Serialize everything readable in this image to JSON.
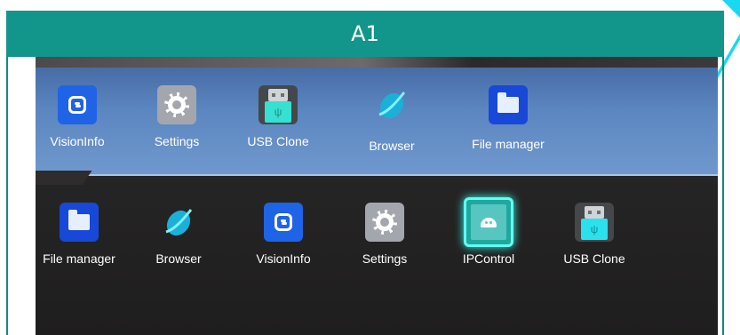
{
  "header": {
    "title": "A1"
  },
  "photo": {
    "top_panel_items": [
      {
        "label": "VisionInfo",
        "icon": "visioninfo-icon"
      },
      {
        "label": "Settings",
        "icon": "settings-gear-icon"
      },
      {
        "label": "USB Clone",
        "icon": "usb-drive-icon"
      },
      {
        "label": "Browser",
        "icon": "browser-icon"
      },
      {
        "label": "File manager",
        "icon": "folder-icon"
      }
    ],
    "bottom_row_items": [
      {
        "label": "File manager",
        "icon": "folder-icon"
      },
      {
        "label": "Browser",
        "icon": "browser-icon"
      },
      {
        "label": "VisionInfo",
        "icon": "visioninfo-icon"
      },
      {
        "label": "Settings",
        "icon": "settings-gear-icon"
      },
      {
        "label": "IPControl",
        "icon": "android-icon"
      },
      {
        "label": "USB Clone",
        "icon": "usb-drive-icon"
      }
    ]
  },
  "colors": {
    "header_bg": "#12958a",
    "top_panel": "#5c86c0",
    "selected_glow": "#63fff0"
  }
}
